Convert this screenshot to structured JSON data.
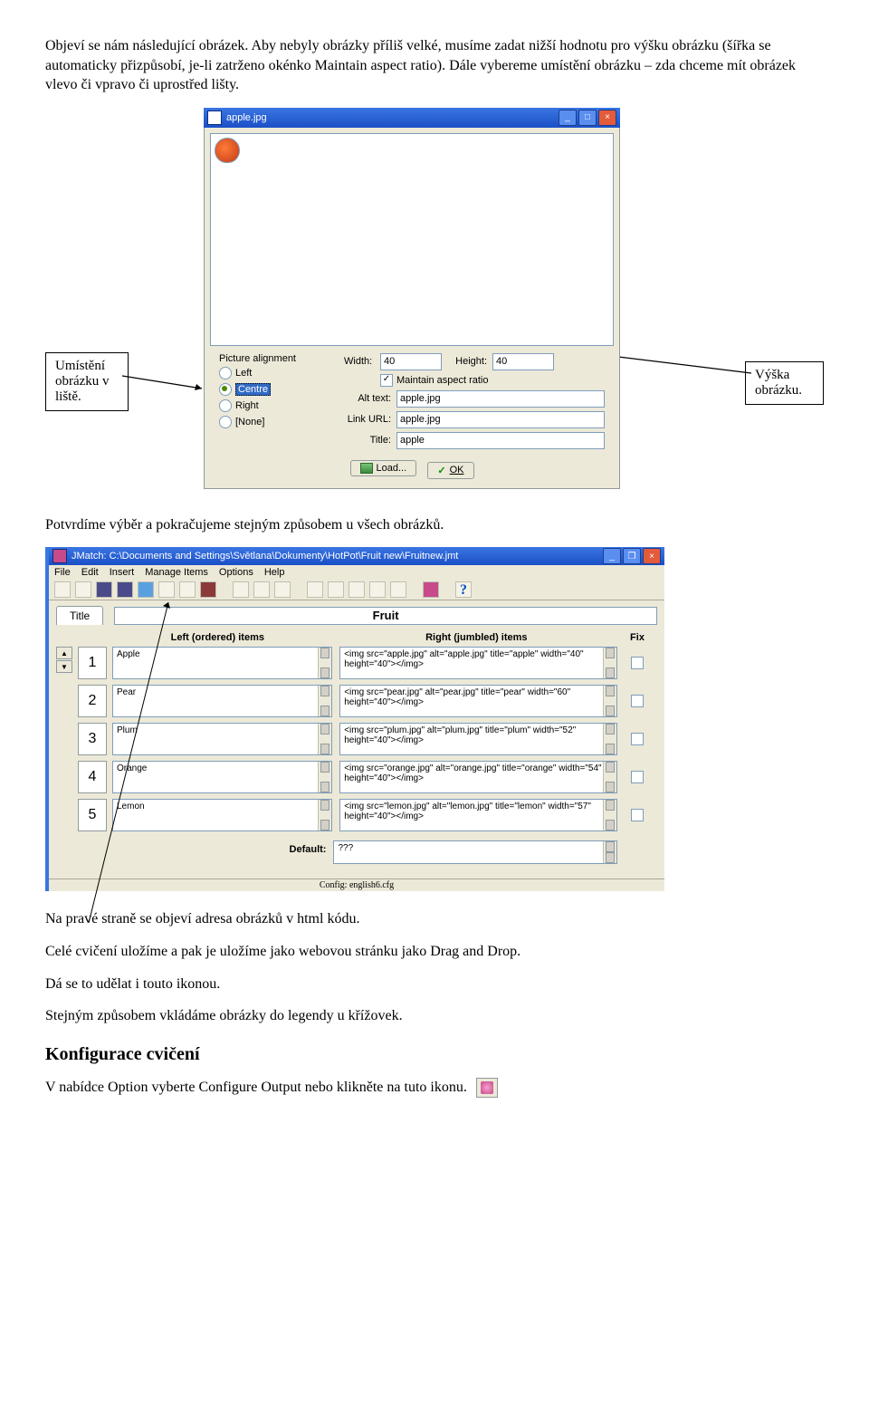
{
  "para1": "Objeví se nám následující obrázek. Aby nebyly obrázky příliš velké, musíme zadat nižší hodnotu pro výšku obrázku (šířka se automaticky přizpůsobí, je-li zatrženo okénko Maintain aspect ratio). Dále vybereme umístění obrázku – zda chceme mít obrázek vlevo či vpravo či uprostřed lišty.",
  "callout_left": "Umístění obrázku v liště.",
  "callout_right": "Výška obrázku.",
  "dlg": {
    "title": "apple.jpg",
    "alignment_label": "Picture alignment",
    "opt_left": "Left",
    "opt_centre": "Centre",
    "opt_right": "Right",
    "opt_none": "[None]",
    "width_label": "Width:",
    "width_val": "40",
    "height_label": "Height:",
    "height_val": "40",
    "maintain": "Maintain aspect ratio",
    "alt_label": "Alt text:",
    "alt_val": "apple.jpg",
    "link_label": "Link URL:",
    "link_val": "apple.jpg",
    "title_label": "Title:",
    "title_val": "apple",
    "load": "Load...",
    "ok": "OK"
  },
  "para2": "Potvrdíme výběr a pokračujeme stejným způsobem u všech obrázků.",
  "jm": {
    "title": "JMatch: C:\\Documents and Settings\\Světlana\\Dokumenty\\HotPot\\Fruit new\\Fruitnew.jmt",
    "menu": [
      "File",
      "Edit",
      "Insert",
      "Manage Items",
      "Options",
      "Help"
    ],
    "title_tab": "Title",
    "title_val": "Fruit",
    "hdr_left": "Left (ordered) items",
    "hdr_right": "Right (jumbled) items",
    "hdr_fix": "Fix",
    "rows": [
      {
        "n": "1",
        "left": "Apple",
        "right": "<img src=\"apple.jpg\" alt=\"apple.jpg\" title=\"apple\" width=\"40\" height=\"40\"></img>"
      },
      {
        "n": "2",
        "left": "Pear",
        "right": "<img src=\"pear.jpg\" alt=\"pear.jpg\" title=\"pear\" width=\"60\" height=\"40\"></img>"
      },
      {
        "n": "3",
        "left": "Plum",
        "right": "<img src=\"plum.jpg\" alt=\"plum.jpg\" title=\"plum\" width=\"52\" height=\"40\"></img>"
      },
      {
        "n": "4",
        "left": "Orange",
        "right": "<img src=\"orange.jpg\" alt=\"orange.jpg\" title=\"orange\" width=\"54\" height=\"40\"></img>"
      },
      {
        "n": "5",
        "left": "Lemon",
        "right": "<img src=\"lemon.jpg\" alt=\"lemon.jpg\" title=\"lemon\" width=\"57\" height=\"40\"></img>"
      }
    ],
    "default_label": "Default:",
    "default_val": "???",
    "status": "Config: english6.cfg"
  },
  "para3": "Na pravé straně se objeví adresa obrázků v html kódu.",
  "para4": "Celé cvičení uložíme a pak je uložíme jako webovou stránku jako Drag and Drop.",
  "para5": "Dá se to udělat i touto ikonou.",
  "para6": "Stejným způsobem vkládáme obrázky do legendy u křížovek.",
  "h2": "Konfigurace cvičení",
  "para7": "V nabídce Option vyberte Configure Output nebo klikněte na tuto ikonu."
}
